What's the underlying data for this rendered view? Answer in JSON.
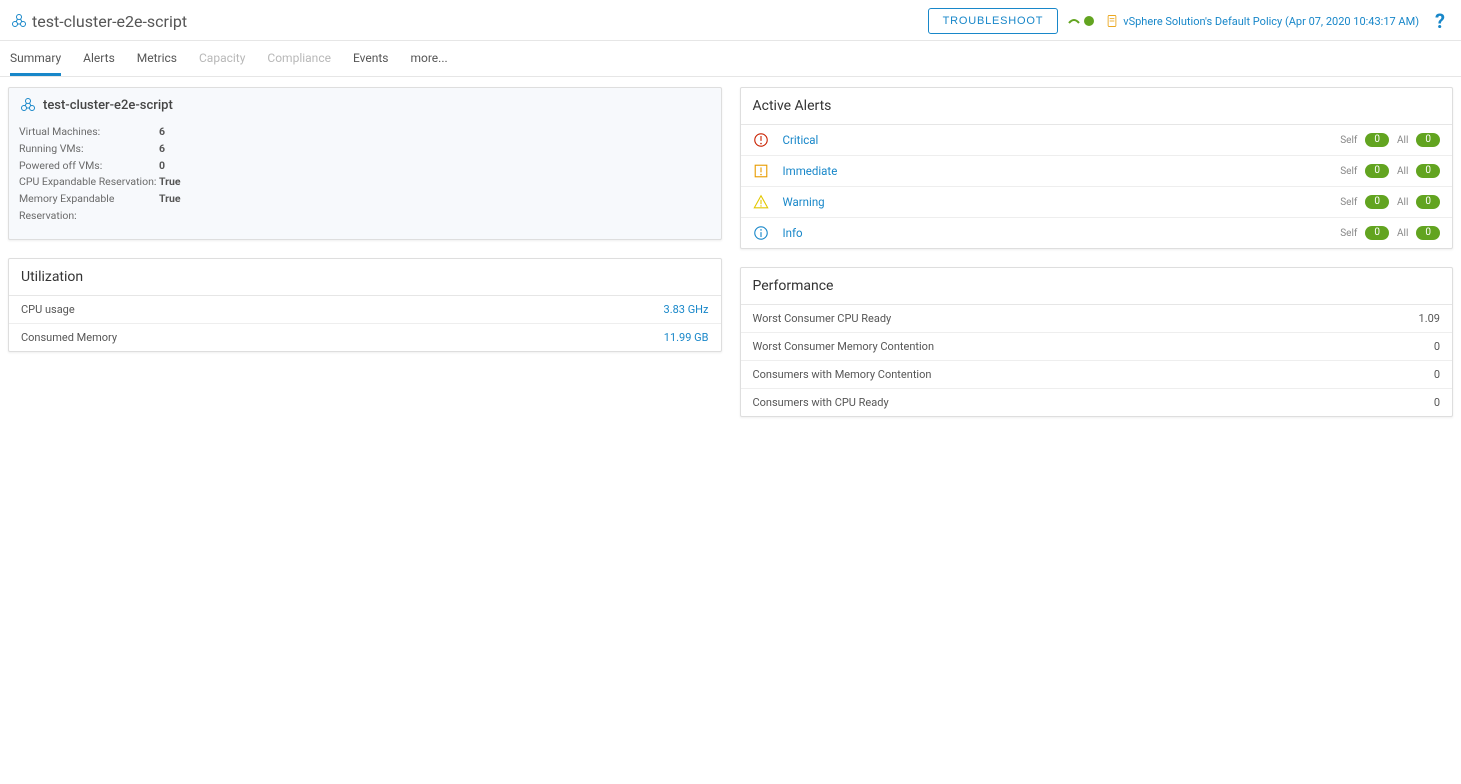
{
  "header": {
    "title": "test-cluster-e2e-script",
    "troubleshoot_label": "TROUBLESHOOT",
    "policy_text": "vSphere Solution's Default Policy (Apr 07, 2020 10:43:17 AM)"
  },
  "tabs": [
    {
      "label": "Summary",
      "state": "active"
    },
    {
      "label": "Alerts",
      "state": ""
    },
    {
      "label": "Metrics",
      "state": ""
    },
    {
      "label": "Capacity",
      "state": "disabled"
    },
    {
      "label": "Compliance",
      "state": "disabled"
    },
    {
      "label": "Events",
      "state": ""
    },
    {
      "label": "more...",
      "state": "more"
    }
  ],
  "overview": {
    "title": "test-cluster-e2e-script",
    "props": [
      {
        "key": "Virtual Machines:",
        "val": "6"
      },
      {
        "key": "Running VMs:",
        "val": "6"
      },
      {
        "key": "Powered off VMs:",
        "val": "0"
      },
      {
        "key": "CPU Expandable Reservation:",
        "val": "True"
      },
      {
        "key": "Memory Expandable Reservation:",
        "val": "True"
      }
    ]
  },
  "utilization": {
    "title": "Utilization",
    "rows": [
      {
        "name": "CPU usage",
        "val": "3.83 GHz"
      },
      {
        "name": "Consumed Memory",
        "val": "11.99 GB"
      }
    ]
  },
  "active_alerts": {
    "title": "Active Alerts",
    "self_label": "Self",
    "all_label": "All",
    "rows": [
      {
        "label": "Critical",
        "icon": "critical",
        "self": "0",
        "all": "0"
      },
      {
        "label": "Immediate",
        "icon": "immediate",
        "self": "0",
        "all": "0"
      },
      {
        "label": "Warning",
        "icon": "warning",
        "self": "0",
        "all": "0"
      },
      {
        "label": "Info",
        "icon": "info",
        "self": "0",
        "all": "0"
      }
    ]
  },
  "performance": {
    "title": "Performance",
    "rows": [
      {
        "name": "Worst Consumer CPU Ready",
        "val": "1.09"
      },
      {
        "name": "Worst Consumer Memory Contention",
        "val": "0"
      },
      {
        "name": "Consumers with Memory Contention",
        "val": "0"
      },
      {
        "name": "Consumers with CPU Ready",
        "val": "0"
      }
    ]
  }
}
